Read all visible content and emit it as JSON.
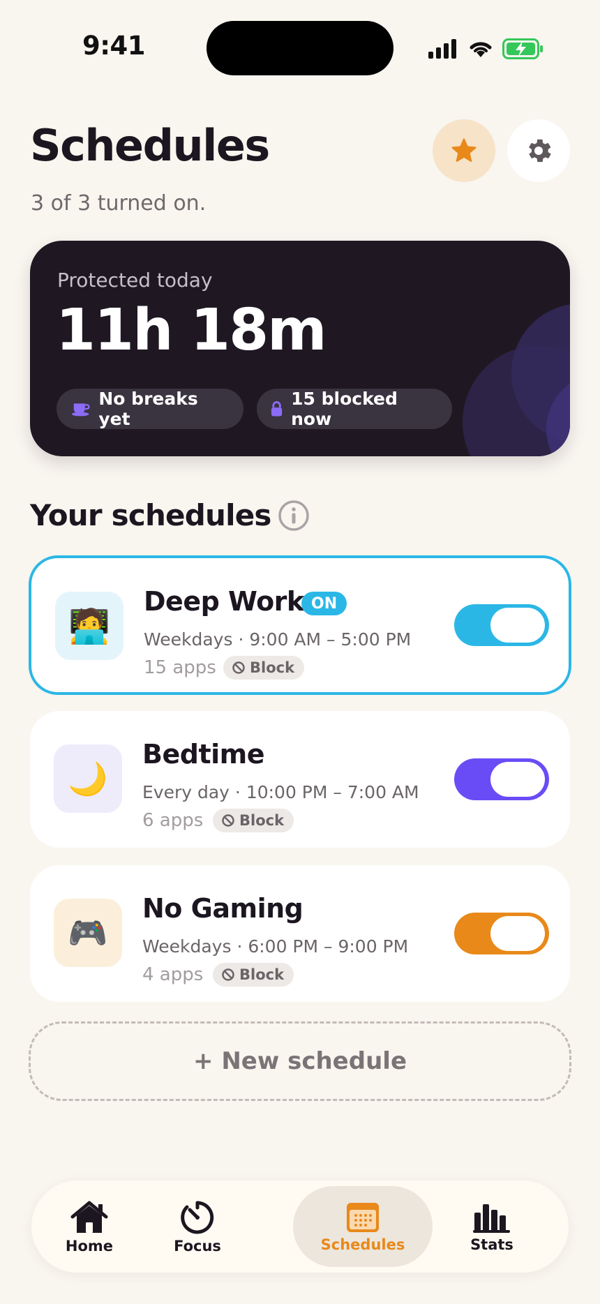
{
  "status_bar": {
    "time": "9:41",
    "icons": [
      "cellular-signal-icon",
      "wifi-icon",
      "battery-charging-icon"
    ]
  },
  "header": {
    "title": "Schedules",
    "subtitle": "3 of 3 turned on.",
    "pro_icon": "star-icon",
    "settings_icon": "gear-icon"
  },
  "hero": {
    "label": "Protected today",
    "value": "11h 18m",
    "chips": [
      {
        "icon": "coffee-cup-icon",
        "label": "No breaks yet"
      },
      {
        "icon": "lock-icon",
        "label": "15 blocked now"
      }
    ]
  },
  "schedules_section": {
    "title": "Your schedules",
    "info_icon": "info-icon"
  },
  "schedules": [
    {
      "name": "Deep Work",
      "badge": "ON",
      "emoji": "🧑‍💻",
      "icon_name": "technologist-icon",
      "timing": "Weekdays · 9:00 AM – 5:00 PM",
      "apps": "15 apps",
      "mode": "Block",
      "enabled": true,
      "accent": "#2bb7e6",
      "icon_bg": "#e4f4fb"
    },
    {
      "name": "Bedtime",
      "emoji": "🌙",
      "icon_name": "crescent-moon-icon",
      "timing": "Every day · 10:00 PM – 7:00 AM",
      "apps": "6 apps",
      "mode": "Block",
      "enabled": true,
      "accent": "#6a4cf6",
      "icon_bg": "#eeebfb"
    },
    {
      "name": "No Gaming",
      "emoji": "🎮",
      "icon_name": "game-controller-icon",
      "timing": "Weekdays · 6:00 PM – 9:00 PM",
      "apps": "4 apps",
      "mode": "Block",
      "enabled": true,
      "accent": "#e8891a",
      "icon_bg": "#fbefdc"
    }
  ],
  "new_schedule_label": "+ New schedule",
  "tabbar": {
    "tabs": [
      {
        "label": "Home",
        "icon": "house-icon",
        "selected": false
      },
      {
        "label": "Focus",
        "icon": "timer-icon",
        "selected": false
      },
      {
        "label": "Schedules",
        "icon": "calendar-icon",
        "selected": true
      },
      {
        "label": "Stats",
        "icon": "bar-chart-icon",
        "selected": false
      }
    ]
  },
  "colors": {
    "background": "#f9f5ef",
    "hero_background": "#1f1823",
    "accent_orange": "#e8891a",
    "accent_blue": "#2bb7e6",
    "accent_purple": "#6a4cf6"
  }
}
